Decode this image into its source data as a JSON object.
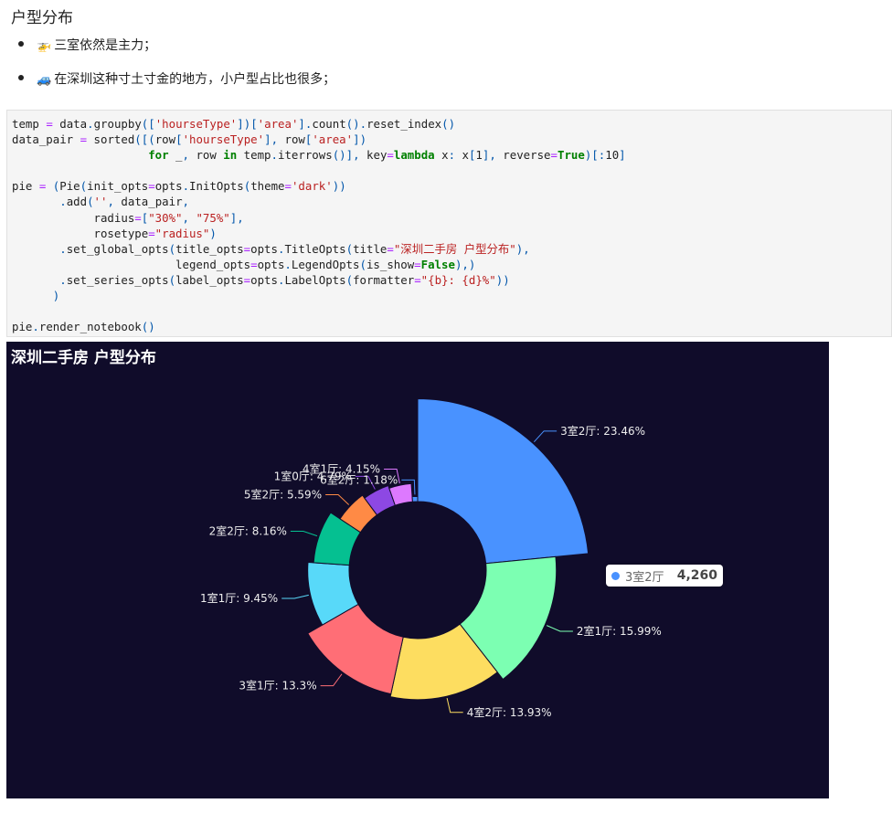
{
  "markdown": {
    "heading": "户型分布",
    "bullets": [
      {
        "emoji": "🚁",
        "text": "三室依然是主力；"
      },
      {
        "emoji": "🚙",
        "text": "在深圳这种寸土寸金的地方，小户型占比也很多；"
      }
    ]
  },
  "code_lines": [
    "temp = data.groupby(['hourseType'])['area'].count().reset_index()",
    "data_pair = sorted([(row['hourseType'], row['area'])",
    "                    for _, row in temp.iterrows()], key=lambda x: x[1], reverse=True)[:10]",
    "",
    "pie = (Pie(init_opts=opts.InitOpts(theme='dark'))",
    "       .add('', data_pair,",
    "            radius=[\"30%\", \"75%\"],",
    "            rosetype=\"radius\")",
    "       .set_global_opts(title_opts=opts.TitleOpts(title=\"深圳二手房 户型分布\"),",
    "                        legend_opts=opts.LegendOpts(is_show=False),)",
    "       .set_series_opts(label_opts=opts.LabelOpts(formatter=\"{b}: {d}%\"))",
    "      )",
    "",
    "pie.render_notebook()"
  ],
  "chart_data": {
    "type": "pie",
    "variant": "rose-radius",
    "title": "深圳二手房 户型分布",
    "slices": [
      {
        "name": "3室2厅",
        "percent": 23.46,
        "color": "#4992ff"
      },
      {
        "name": "2室1厅",
        "percent": 15.99,
        "color": "#7cffb2"
      },
      {
        "name": "4室2厅",
        "percent": 13.93,
        "color": "#fddd60"
      },
      {
        "name": "3室1厅",
        "percent": 13.3,
        "color": "#ff6e76"
      },
      {
        "name": "1室1厅",
        "percent": 9.45,
        "color": "#58d9f9"
      },
      {
        "name": "2室2厅",
        "percent": 8.16,
        "color": "#05c091"
      },
      {
        "name": "5室2厅",
        "percent": 5.59,
        "color": "#ff8a45"
      },
      {
        "name": "1室0厅",
        "percent": 4.79,
        "color": "#8d48e3"
      },
      {
        "name": "4室1厅",
        "percent": 4.15,
        "color": "#dd79ff"
      },
      {
        "name": "6室2厅",
        "percent": 1.18,
        "color": "#4992ff"
      }
    ],
    "legend": "hidden",
    "background": "#100c2a"
  },
  "tooltip": {
    "name": "3室2厅",
    "value": "4,260",
    "color": "#4992ff"
  }
}
